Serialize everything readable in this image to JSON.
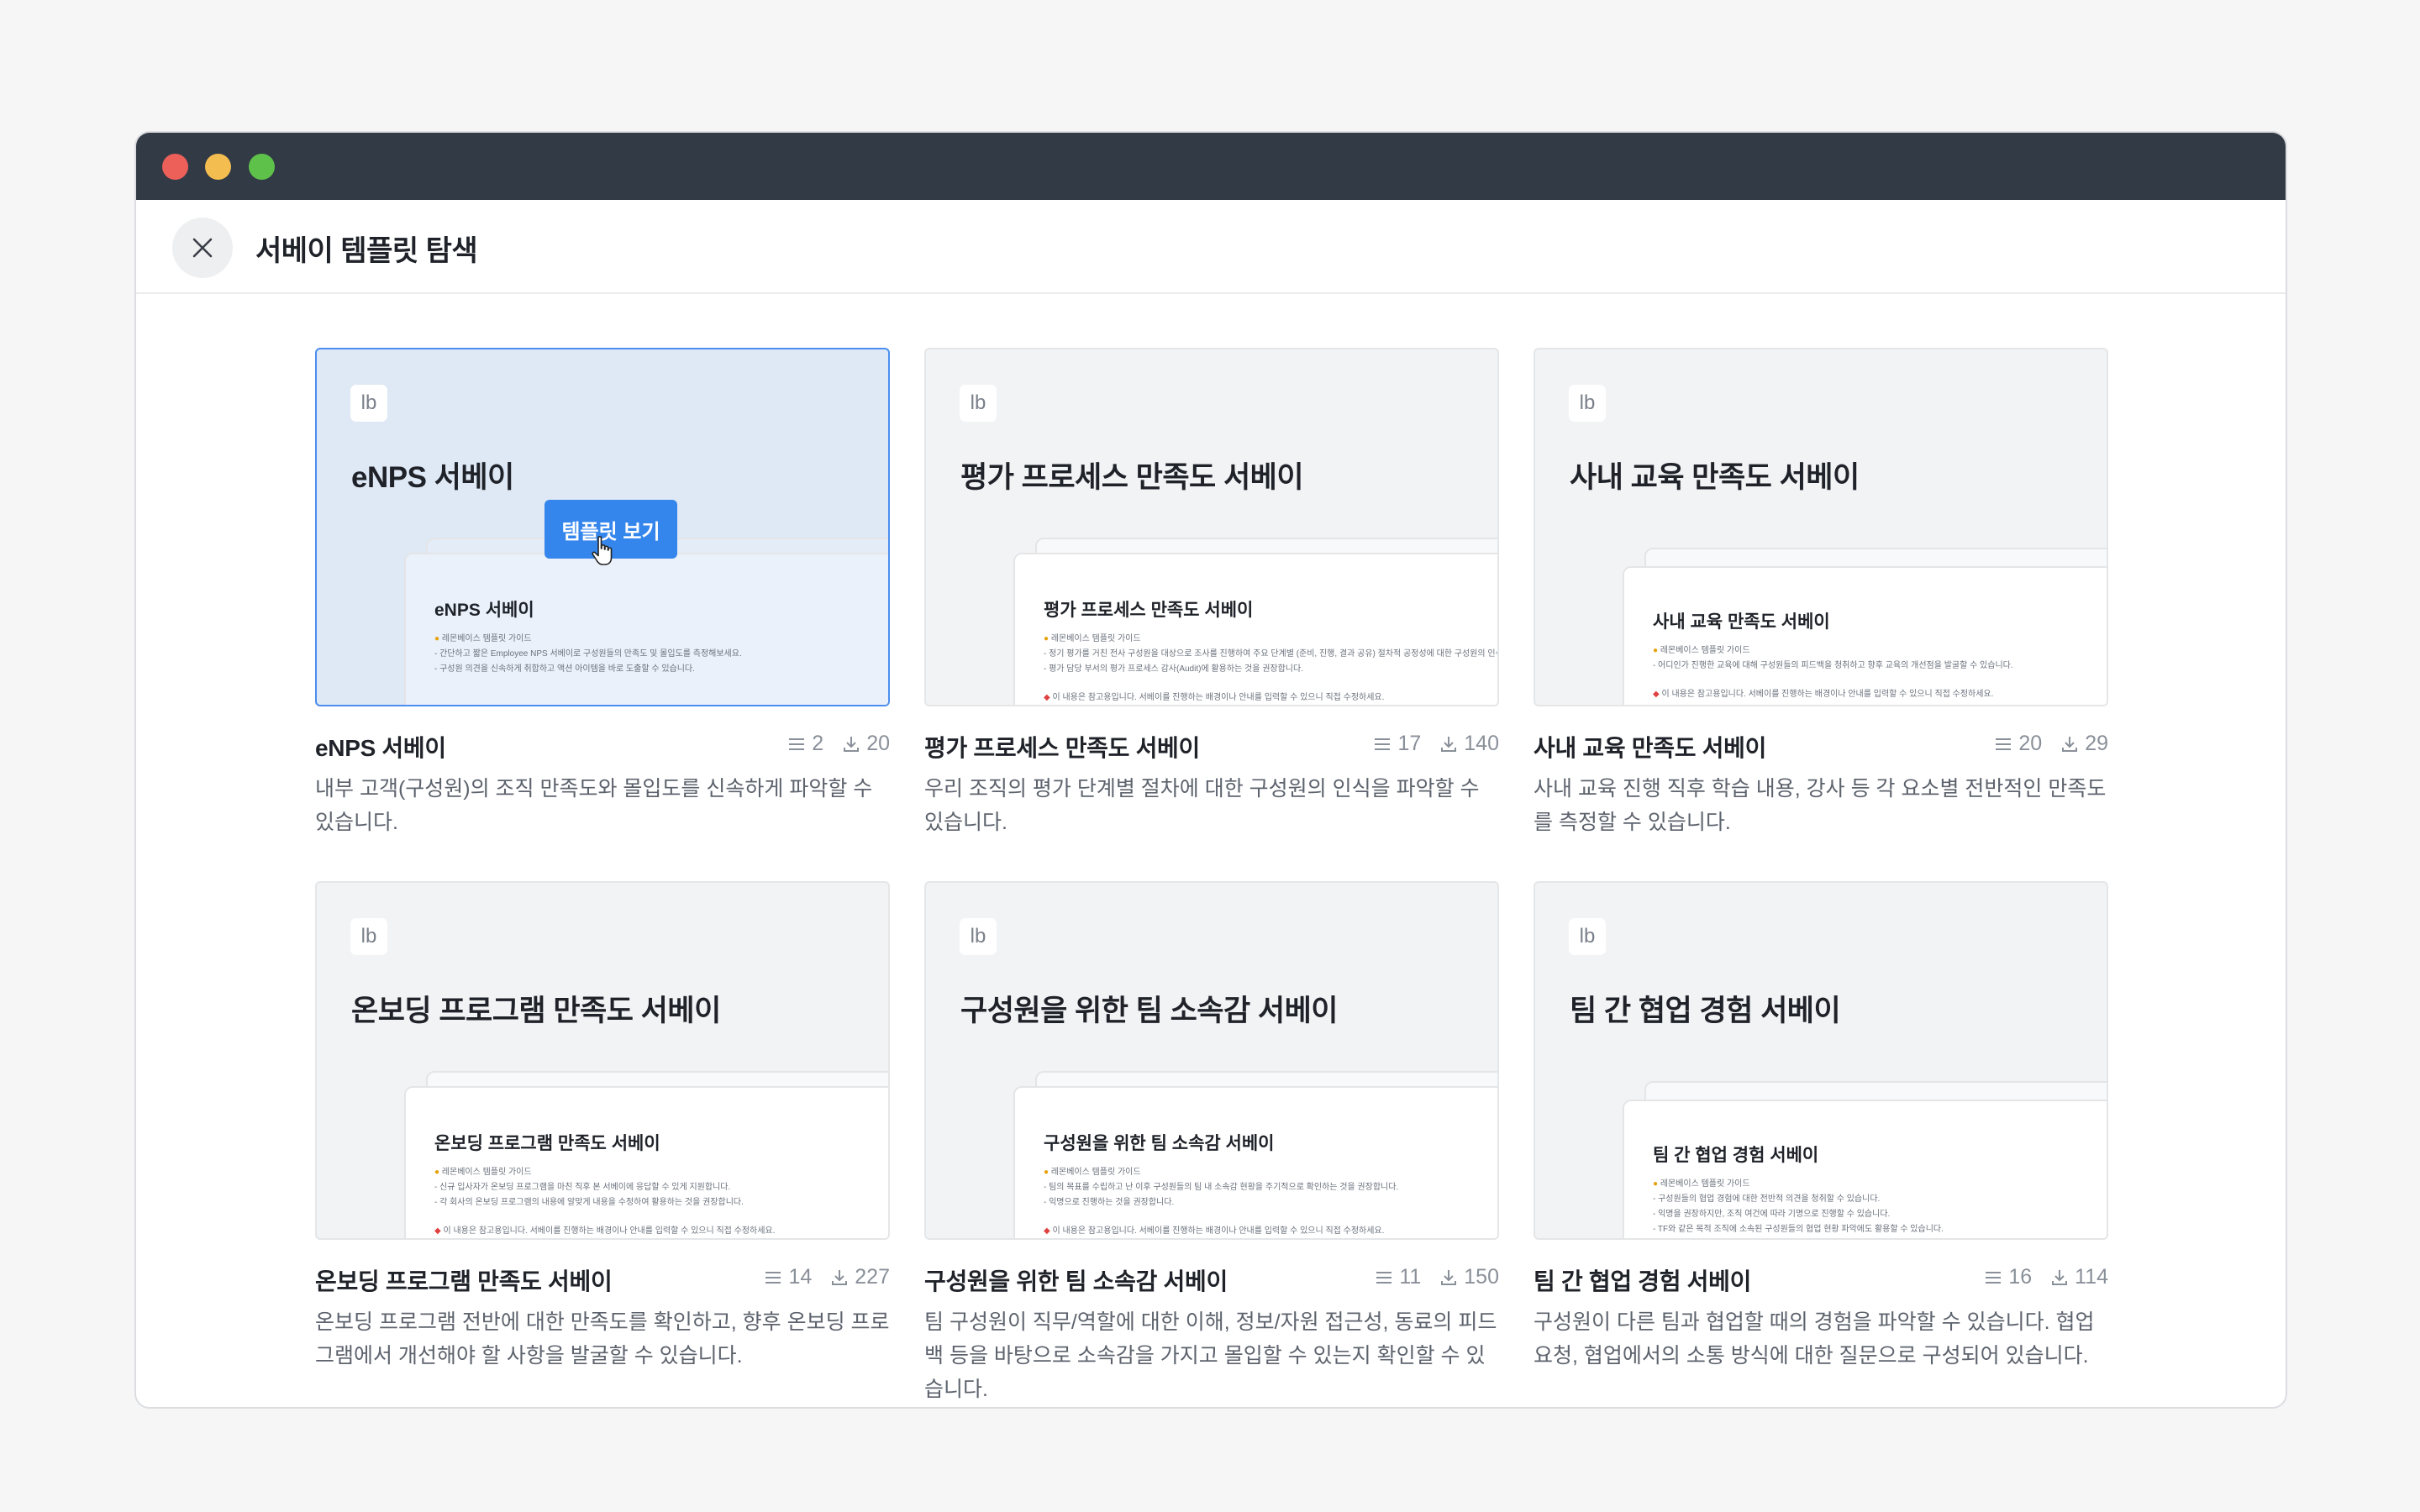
{
  "dialog": {
    "title": "서베이 템플릿 탐색",
    "close_icon": "close-icon"
  },
  "hover": {
    "button_label": "템플릿 보기"
  },
  "logo_text": "lb",
  "templates": [
    {
      "title": "eNPS 서베이",
      "questions": "2",
      "downloads": "20",
      "description": "내부 고객(구성원)의 조직 만족도와 몰입도를 신속하게 파악할 수 있습니다.",
      "sheet_guide": "레몬베이스 템플릿 가이드",
      "sheet_lines": [
        "- 간단하고 짧은 Employee NPS 서베이로 구성원들의 만족도 및 몰입도를 측정해보세요.",
        "- 구성원 의견을 신속하게 취합하고 액션 아이템을 바로 도출할 수 있습니다."
      ],
      "sheet_note": ""
    },
    {
      "title": "평가 프로세스 만족도 서베이",
      "questions": "17",
      "downloads": "140",
      "description": "우리 조직의 평가 단계별 절차에 대한 구성원의 인식을 파악할 수 있습니다.",
      "sheet_guide": "레몬베이스 템플릿 가이드",
      "sheet_lines": [
        "- 정기 평가를 거친 전사 구성원을 대상으로 조사를 진행하여 주요 단계별 (준비, 진행, 결과 공유) 절차적 공정성에 대한 구성원의 인식",
        "- 평가 담당 부서의 평가 프로세스 감사(Audit)에 활용하는 것을 권장합니다."
      ],
      "sheet_note": "이 내용은 참고용입니다. 서베이를 진행하는 배경이나 안내를 입력할 수 있으니 직접 수정하세요."
    },
    {
      "title": "사내 교육 만족도 서베이",
      "questions": "20",
      "downloads": "29",
      "description": "사내 교육 진행 직후 학습 내용, 강사 등 각 요소별 전반적인 만족도를 측정할 수 있습니다.",
      "sheet_guide": "레몬베이스 템플릿 가이드",
      "sheet_lines": [
        "- 어디인가 진행한 교육에 대해 구성원들의 피드백을 청취하고 향후 교육의 개선점을 발굴할 수 있습니다."
      ],
      "sheet_note": "이 내용은 참고용입니다. 서베이를 진행하는 배경이나 안내를 입력할 수 있으니 직접 수정하세요."
    },
    {
      "title": "온보딩 프로그램 만족도 서베이",
      "questions": "14",
      "downloads": "227",
      "description": "온보딩 프로그램 전반에 대한 만족도를 확인하고, 향후 온보딩 프로그램에서 개선해야 할 사항을 발굴할 수 있습니다.",
      "sheet_guide": "레몬베이스 템플릿 가이드",
      "sheet_lines": [
        "- 신규 입사자가 온보딩 프로그램을 마친 직후 본 서베이에 응답할 수 있게 지원합니다.",
        "- 각 회사의 온보딩 프로그램의 내용에 알맞게 내용을 수정하여 활용하는 것을 권장합니다."
      ],
      "sheet_note": "이 내용은 참고용입니다. 서베이를 진행하는 배경이나 안내를 입력할 수 있으니 직접 수정하세요."
    },
    {
      "title": "구성원을 위한 팀 소속감 서베이",
      "questions": "11",
      "downloads": "150",
      "description": "팀 구성원이 직무/역할에 대한 이해, 정보/자원 접근성, 동료의 피드백 등을 바탕으로 소속감을 가지고 몰입할 수 있는지 확인할 수 있습니다.",
      "sheet_guide": "레몬베이스 템플릿 가이드",
      "sheet_lines": [
        "- 팀의 목표를 수립하고 난 이후 구성원들의 팀 내 소속감 현황을 주기적으로 확인하는 것을 권장합니다.",
        "- 익명으로 진행하는 것을 권장합니다."
      ],
      "sheet_note": "이 내용은 참고용입니다. 서베이를 진행하는 배경이나 안내를 입력할 수 있으니 직접 수정하세요."
    },
    {
      "title": "팀 간 협업 경험 서베이",
      "questions": "16",
      "downloads": "114",
      "description": "구성원이 다른 팀과 협업할 때의 경험을 파악할 수 있습니다. 협업 요청, 협업에서의 소통 방식에 대한 질문으로 구성되어 있습니다.",
      "sheet_guide": "레몬베이스 템플릿 가이드",
      "sheet_lines": [
        "- 구성원들의 협업 경험에 대한 전반적 의견을 청취할 수 있습니다.",
        "- 익명을 권장하지만, 조직 여건에 따라 기명으로 진행할 수 있습니다.",
        "- TF와 같은 목적 조직에 소속된 구성원들의 협업 현황 파악에도 활용할 수 있습니다."
      ],
      "sheet_note": ""
    }
  ]
}
